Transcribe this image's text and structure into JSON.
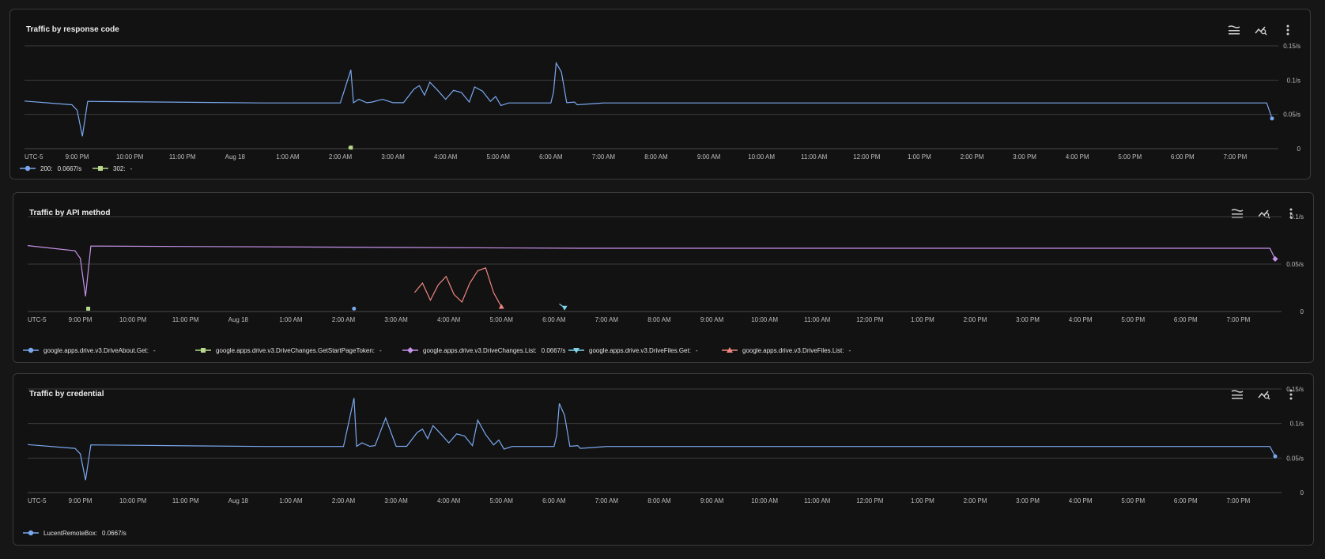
{
  "colors": {
    "blue": "#7aa8ef",
    "green": "#b5d88a",
    "purple": "#c792ea",
    "cyan": "#7fd3ea",
    "red": "#f0877f"
  },
  "icons": [
    "legend-toggle-icon",
    "explore-icon",
    "more-vert-icon"
  ],
  "x_ticks": [
    "UTC-5",
    "9:00 PM",
    "10:00 PM",
    "11:00 PM",
    "Aug 18",
    "1:00 AM",
    "2:00 AM",
    "3:00 AM",
    "4:00 AM",
    "5:00 AM",
    "6:00 AM",
    "7:00 AM",
    "8:00 AM",
    "9:00 AM",
    "10:00 AM",
    "11:00 AM",
    "12:00 PM",
    "1:00 PM",
    "2:00 PM",
    "3:00 PM",
    "4:00 PM",
    "5:00 PM",
    "6:00 PM",
    "7:00 PM"
  ],
  "charts": [
    {
      "title": "Traffic by response code",
      "legend": [
        {
          "label": "200:",
          "value": "0.0667/s",
          "marker": "circle",
          "color": "#7aa8ef"
        },
        {
          "label": "302:",
          "value": "-",
          "marker": "square",
          "color": "#b5d88a"
        }
      ]
    },
    {
      "title": "Traffic by API method",
      "legend": [
        {
          "label": "google.apps.drive.v3.DriveAbout.Get:",
          "value": "-",
          "marker": "circle",
          "color": "#7aa8ef"
        },
        {
          "label": "google.apps.drive.v3.DriveChanges.GetStartPageToken:",
          "value": "-",
          "marker": "square",
          "color": "#b5d88a"
        },
        {
          "label": "google.apps.drive.v3.DriveChanges.List:",
          "value": "0.0667/s",
          "marker": "diamond",
          "color": "#c792ea"
        },
        {
          "label": "google.apps.drive.v3.DriveFiles.Get:",
          "value": "-",
          "marker": "triangle-down",
          "color": "#7fd3ea"
        },
        {
          "label": "google.apps.drive.v3.DriveFiles.List:",
          "value": "-",
          "marker": "triangle-up",
          "color": "#f0877f"
        }
      ]
    },
    {
      "title": "Traffic by credential",
      "legend": [
        {
          "label": "LucentRemoteBox:",
          "value": "0.0667/s",
          "marker": "circle",
          "color": "#7aa8ef"
        }
      ]
    }
  ],
  "chart_data": [
    {
      "type": "line",
      "title": "Traffic by response code",
      "x_unit": "hours since 8:00 PM (UTC-5)",
      "xlim": [
        0,
        23.7
      ],
      "y_ticks": [
        "0",
        "0.05/s",
        "0.1/s",
        "0.15/s"
      ],
      "y_tick_values": [
        0,
        0.05,
        0.1,
        0.15
      ],
      "ylim": [
        0,
        0.15
      ],
      "grid": true,
      "series": [
        {
          "name": "200",
          "color": "#7aa8ef",
          "x": [
            0,
            0.9,
            1.0,
            1.1,
            1.2,
            4.5,
            6.0,
            6.2,
            6.25,
            6.35,
            6.5,
            6.6,
            6.8,
            7.0,
            7.2,
            7.4,
            7.5,
            7.6,
            7.7,
            7.85,
            8.0,
            8.15,
            8.3,
            8.45,
            8.55,
            8.7,
            8.85,
            8.95,
            9.05,
            9.2,
            10.0,
            10.05,
            10.1,
            10.2,
            10.3,
            10.45,
            10.5,
            11.0,
            12.0,
            13.0,
            14.0,
            15.0,
            16.0,
            17.0,
            18.0,
            19.0,
            20.0,
            21.0,
            22.0,
            23.5,
            23.6,
            23.7
          ],
          "y": [
            0.0695,
            0.064,
            0.056,
            0.018,
            0.069,
            0.0667,
            0.0667,
            0.115,
            0.067,
            0.072,
            0.067,
            0.068,
            0.072,
            0.067,
            0.067,
            0.087,
            0.092,
            0.078,
            0.097,
            0.085,
            0.072,
            0.085,
            0.082,
            0.068,
            0.09,
            0.084,
            0.069,
            0.076,
            0.063,
            0.0667,
            0.0667,
            0.083,
            0.125,
            0.112,
            0.067,
            0.068,
            0.064,
            0.0667,
            0.0667,
            0.0667,
            0.0667,
            0.0667,
            0.0667,
            0.0667,
            0.0667,
            0.0667,
            0.0667,
            0.0667,
            0.0667,
            0.0667,
            0.0667,
            0.044
          ]
        },
        {
          "name": "302",
          "color": "#b5d88a",
          "x": [
            6.15,
            6.2
          ],
          "y": [
            0.0015,
            0.0015
          ]
        }
      ]
    },
    {
      "type": "line",
      "title": "Traffic by API method",
      "x_unit": "hours since 8:00 PM (UTC-5)",
      "xlim": [
        0,
        23.7
      ],
      "y_ticks": [
        "0",
        "0.05/s",
        "0.1/s"
      ],
      "y_tick_values": [
        0,
        0.05,
        0.1
      ],
      "ylim": [
        0,
        0.1
      ],
      "grid": true,
      "series": [
        {
          "name": "google.apps.drive.v3.DriveAbout.Get",
          "color": "#7aa8ef",
          "x": [
            6.2
          ],
          "y": [
            0.003
          ]
        },
        {
          "name": "google.apps.drive.v3.DriveChanges.GetStartPageToken",
          "color": "#b5d88a",
          "x": [
            1.15
          ],
          "y": [
            0.003
          ]
        },
        {
          "name": "google.apps.drive.v3.DriveChanges.List",
          "color": "#c792ea",
          "x": [
            0,
            0.9,
            1.0,
            1.1,
            1.2,
            10.5,
            11.0,
            12.0,
            13.0,
            14.0,
            15.0,
            16.0,
            17.0,
            18.0,
            19.0,
            20.0,
            21.0,
            22.0,
            23.5,
            23.6,
            23.7
          ],
          "y": [
            0.0695,
            0.064,
            0.056,
            0.016,
            0.069,
            0.0667,
            0.0667,
            0.0667,
            0.0667,
            0.0667,
            0.0667,
            0.0667,
            0.0667,
            0.0667,
            0.0667,
            0.0667,
            0.0667,
            0.0667,
            0.0667,
            0.0667,
            0.0554
          ]
        },
        {
          "name": "google.apps.drive.v3.DriveFiles.Get",
          "color": "#7fd3ea",
          "x": [
            10.1,
            10.2
          ],
          "y": [
            0.008,
            0.004
          ]
        },
        {
          "name": "google.apps.drive.v3.DriveFiles.List",
          "color": "#f0877f",
          "x": [
            7.35,
            7.5,
            7.65,
            7.8,
            7.95,
            8.1,
            8.25,
            8.4,
            8.55,
            8.7,
            8.85,
            9.0
          ],
          "y": [
            0.02,
            0.03,
            0.012,
            0.028,
            0.037,
            0.018,
            0.01,
            0.03,
            0.043,
            0.046,
            0.02,
            0.005
          ]
        }
      ]
    },
    {
      "type": "line",
      "title": "Traffic by credential",
      "x_unit": "hours since 8:00 PM (UTC-5)",
      "xlim": [
        0,
        23.7
      ],
      "y_ticks": [
        "0",
        "0.05/s",
        "0.1/s",
        "0.15/s"
      ],
      "y_tick_values": [
        0,
        0.05,
        0.1,
        0.15
      ],
      "ylim": [
        0,
        0.15
      ],
      "grid": true,
      "series": [
        {
          "name": "LucentRemoteBox",
          "color": "#7aa8ef",
          "x": [
            0,
            0.9,
            1.0,
            1.1,
            1.2,
            4.5,
            6.0,
            6.2,
            6.25,
            6.35,
            6.5,
            6.6,
            6.8,
            7.0,
            7.2,
            7.4,
            7.5,
            7.6,
            7.7,
            7.85,
            8.0,
            8.15,
            8.3,
            8.45,
            8.55,
            8.7,
            8.85,
            8.95,
            9.05,
            9.2,
            10.0,
            10.05,
            10.1,
            10.2,
            10.3,
            10.45,
            10.5,
            11.0,
            12.0,
            13.0,
            14.0,
            15.0,
            16.0,
            17.0,
            18.0,
            19.0,
            20.0,
            21.0,
            22.0,
            23.5,
            23.6,
            23.7
          ],
          "y": [
            0.0695,
            0.064,
            0.056,
            0.018,
            0.069,
            0.0667,
            0.0667,
            0.137,
            0.067,
            0.072,
            0.067,
            0.068,
            0.108,
            0.067,
            0.067,
            0.087,
            0.092,
            0.078,
            0.097,
            0.085,
            0.072,
            0.085,
            0.082,
            0.068,
            0.105,
            0.084,
            0.069,
            0.076,
            0.063,
            0.0667,
            0.0667,
            0.083,
            0.129,
            0.112,
            0.067,
            0.068,
            0.064,
            0.0667,
            0.0667,
            0.0667,
            0.0667,
            0.0667,
            0.0667,
            0.0667,
            0.0667,
            0.0667,
            0.0667,
            0.0667,
            0.0667,
            0.0667,
            0.0667,
            0.0525
          ]
        }
      ]
    }
  ]
}
